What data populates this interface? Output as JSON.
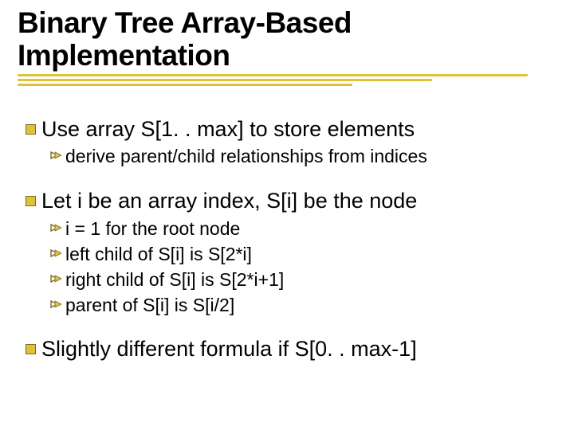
{
  "title": "Binary Tree Array-Based Implementation",
  "bullets": {
    "b1": "Use array S[1. . max] to store elements",
    "b1a": "derive parent/child relationships from indices",
    "b2": "Let i be an array index, S[i] be the node",
    "b2a": "i = 1 for the root node",
    "b2b": "left child of S[i] is S[2*i]",
    "b2c": "right child of S[i] is S[2*i+1]",
    "b2d": "parent of S[i] is S[i/2]",
    "b3": "Slightly different formula if S[0. . max-1]"
  }
}
